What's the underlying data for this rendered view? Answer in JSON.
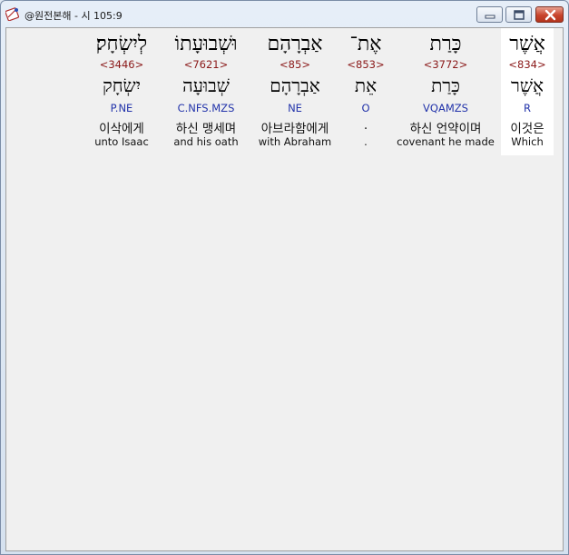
{
  "window": {
    "title": "@원전본해 - 시 105:9",
    "icon": "bible-app-icon",
    "controls": [
      "minimize-icon",
      "maximize-icon",
      "close-icon"
    ],
    "close_color": "#c8442b"
  },
  "interlinear": {
    "selected_index": 0,
    "columns": [
      {
        "hebrew": "אֲשֶׁר",
        "strong": "<834>",
        "lemma": "אֲשֶׁר",
        "morph": "R",
        "korean": "이것은",
        "english": "Which"
      },
      {
        "hebrew": "כָּרַת",
        "strong": "<3772>",
        "lemma": "כָּרַת",
        "morph": "VQAMZS",
        "korean": "하신 언약이며",
        "english": "covenant he made"
      },
      {
        "hebrew": "אֶת־",
        "strong": "<853>",
        "lemma": "אֵת",
        "morph": "O",
        "korean": ".",
        "english": "."
      },
      {
        "hebrew": "אַבְרָהָם",
        "strong": "<85>",
        "lemma": "אַבְרָהָם",
        "morph": "NE",
        "korean": "아브라함에게",
        "english": "with Abraham"
      },
      {
        "hebrew": "וּשְׁבוּעָתוֹ",
        "strong": "<7621>",
        "lemma": "שְׁבוּעָה",
        "morph": "C.NFS.MZS",
        "korean": "하신 맹세며",
        "english": "and his oath"
      },
      {
        "hebrew": "לְיִשְׂחָק׃",
        "strong": "<3446>",
        "lemma": "יִשְׂחָק",
        "morph": "P.NE",
        "korean": "이삭에게",
        "english": "unto Isaac"
      }
    ]
  }
}
